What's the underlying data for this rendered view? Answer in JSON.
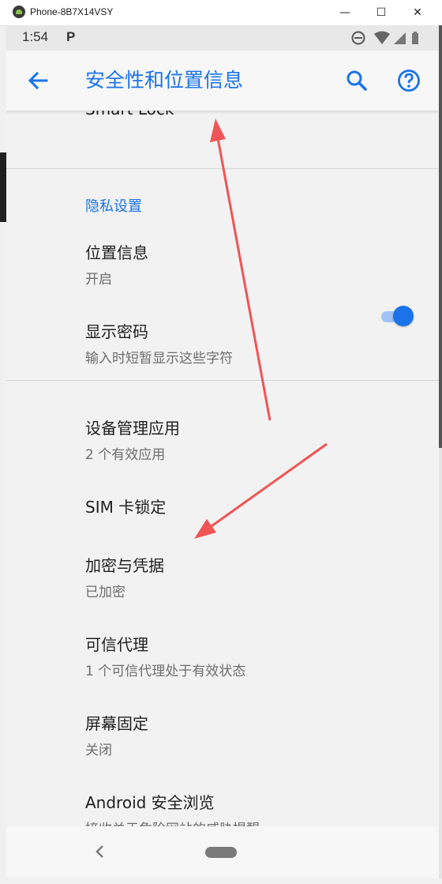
{
  "window": {
    "title": "Phone-8B7X14VSY",
    "minimize_glyph": "—",
    "maximize_glyph": "☐",
    "close_glyph": "✕"
  },
  "status_bar": {
    "time": "1:54",
    "notification_letter": "P",
    "icons": [
      "do-not-disturb-icon",
      "wifi-icon",
      "signal-icon",
      "battery-icon"
    ]
  },
  "app_bar": {
    "title": "安全性和位置信息",
    "icons": [
      "back-arrow-icon",
      "search-icon",
      "help-icon"
    ]
  },
  "list": {
    "partial_item": "Smart Lock",
    "section_privacy": "隐私设置",
    "location": {
      "title": "位置信息",
      "subtitle": "开启"
    },
    "show_password": {
      "title": "显示密码",
      "subtitle": "输入时短暂显示这些字符",
      "toggle_on": true
    },
    "device_admin": {
      "title": "设备管理应用",
      "subtitle": "2 个有效应用"
    },
    "sim_lock": {
      "title": "SIM 卡锁定"
    },
    "encryption": {
      "title": "加密与凭据",
      "subtitle": "已加密"
    },
    "trust_agents": {
      "title": "可信代理",
      "subtitle": "1 个可信代理处于有效状态"
    },
    "screen_pinning": {
      "title": "屏幕固定",
      "subtitle": "关闭"
    },
    "safe_browsing": {
      "title": "Android 安全浏览",
      "subtitle": "接收关于危险网站的威胁提醒"
    }
  },
  "colors": {
    "accent": "#1a73e8",
    "annotation_arrow": "#f05454"
  }
}
